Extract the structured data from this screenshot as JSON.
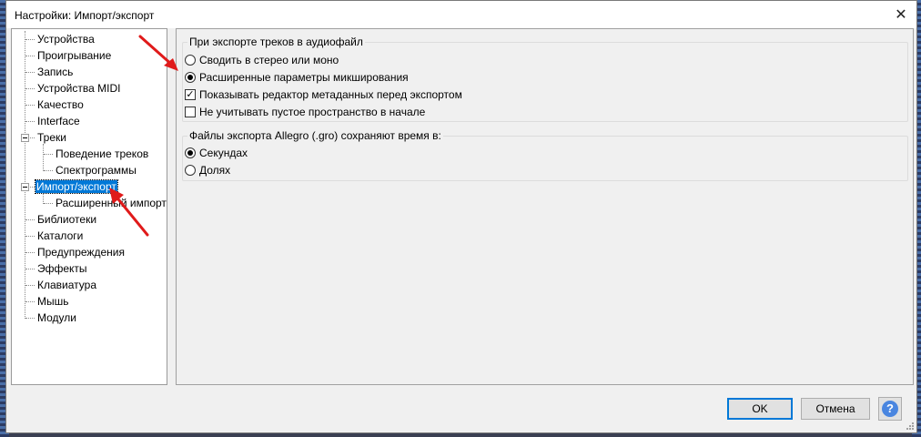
{
  "window": {
    "title": "Настройки: Импорт/экспорт"
  },
  "sidebar": {
    "items": [
      {
        "label": "Устройства"
      },
      {
        "label": "Проигрывание"
      },
      {
        "label": "Запись"
      },
      {
        "label": "Устройства MIDI"
      },
      {
        "label": "Качество"
      },
      {
        "label": "Interface"
      },
      {
        "label": "Треки"
      },
      {
        "label": "Поведение треков"
      },
      {
        "label": "Спектрограммы"
      },
      {
        "label": "Импорт/экспорт"
      },
      {
        "label": "Расширенный импорт"
      },
      {
        "label": "Библиотеки"
      },
      {
        "label": "Каталоги"
      },
      {
        "label": "Предупреждения"
      },
      {
        "label": "Эффекты"
      },
      {
        "label": "Клавиатура"
      },
      {
        "label": "Мышь"
      },
      {
        "label": "Модули"
      }
    ]
  },
  "export_group": {
    "title": "При экспорте треков в аудиофайл",
    "mix_stereo_label": "Сводить в стерео или моно",
    "advanced_mix_label": "Расширенные параметры микширования",
    "show_metadata_label": "Показывать редактор метаданных перед экспортом",
    "ignore_blank_label": "Не учитывать пустое пространство в начале",
    "selected": "advanced_mix",
    "show_metadata_checked": true,
    "ignore_blank_checked": false
  },
  "allegro_group": {
    "title": "Файлы экспорта Allegro (.gro) сохраняют время в:",
    "seconds_label": "Секундах",
    "beats_label": "Долях",
    "selected": "seconds"
  },
  "buttons": {
    "ok": "OK",
    "cancel": "Отмена",
    "help": "?"
  },
  "colors": {
    "selection": "#0078d7",
    "arrow": "#e01a1a",
    "help": "#4a86e0"
  }
}
